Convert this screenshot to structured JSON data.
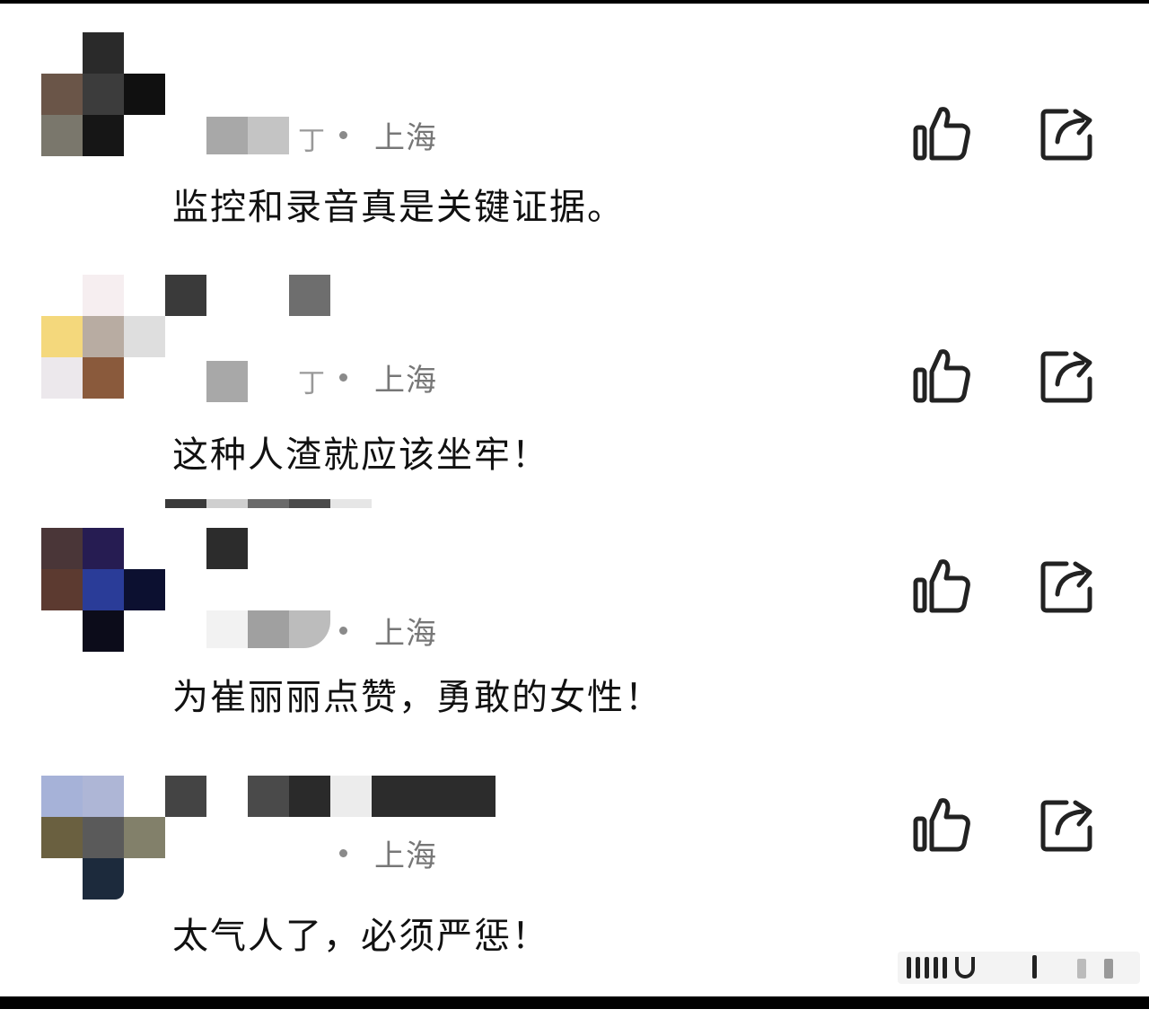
{
  "comments": [
    {
      "location": "上海",
      "text": "监控和录音真是关键证据。",
      "name_fragment": "丁"
    },
    {
      "location": "上海",
      "text": "这种人渣就应该坐牢！",
      "name_fragment": "丁"
    },
    {
      "location": "上海",
      "text": "为崔丽丽点赞，勇敢的女性！",
      "name_fragment": ""
    },
    {
      "location": "上海",
      "text": "太气人了，必须严惩！",
      "name_fragment": ""
    }
  ],
  "icons": {
    "like": "thumbs-up-icon",
    "share": "share-icon"
  },
  "colors": {
    "text": "#111111",
    "meta": "#777777",
    "icon": "#222222"
  }
}
